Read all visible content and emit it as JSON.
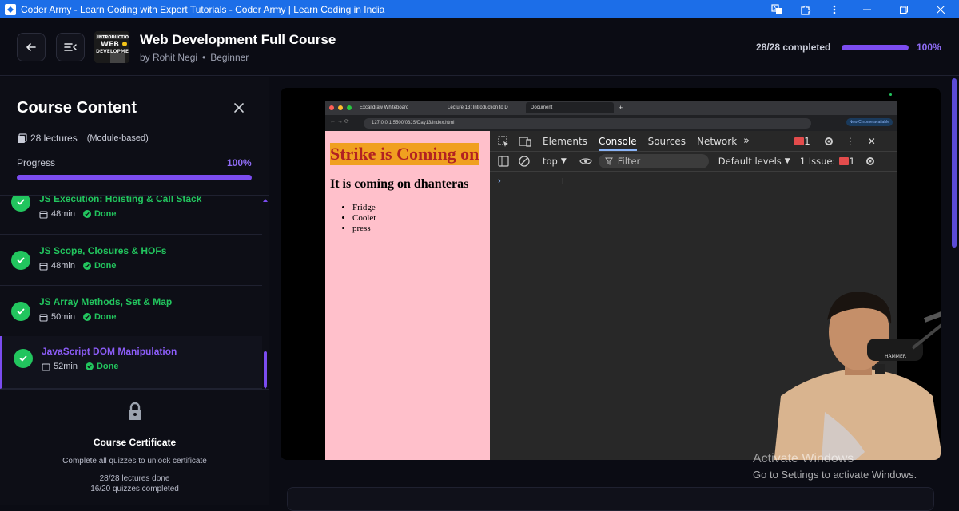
{
  "window": {
    "title": "Coder Army - Learn Coding with Expert Tutorials - Coder Army | Learn Coding in India",
    "controls": [
      "translate-icon",
      "extensions-icon",
      "menu-icon",
      "minimize-icon",
      "maximize-icon",
      "close-icon"
    ]
  },
  "header": {
    "course_title": "Web Development Full Course",
    "author": "by Rohit Negi",
    "level": "Beginner",
    "completed": "28/28 completed",
    "progress_percent": "100%",
    "progress_value": 1.0
  },
  "sidebar": {
    "title": "Course Content",
    "lectures": "28 lectures",
    "mode": "(Module-based)",
    "progress_label": "Progress",
    "progress_percent": "100%",
    "progress_value": 1.0,
    "lessons": [
      {
        "title": "JS Execution: Hoisting & Call Stack",
        "duration": "48min",
        "status": "Done"
      },
      {
        "title": "JS Scope, Closures & HOFs",
        "duration": "48min",
        "status": "Done"
      },
      {
        "title": "JS Array Methods, Set & Map",
        "duration": "50min",
        "status": "Done"
      },
      {
        "title": "JavaScript DOM Manipulation",
        "duration": "52min",
        "status": "Done"
      }
    ],
    "certificate": {
      "title": "Course Certificate",
      "description": "Complete all quizzes to unlock certificate",
      "lectures_done": "28/28 lectures done",
      "quizzes_done": "16/20 quizzes completed"
    }
  },
  "video": {
    "browser_tabs": [
      "Excalidraw Whiteboard",
      "Lecture 13: Introduction to D",
      "Document"
    ],
    "url": "127.0.0.1:5500/03JS/Day13/index.html",
    "new_chrome": "New Chrome available",
    "page": {
      "heading1": "Strike is Coming on",
      "heading2": "It is coming on dhanteras",
      "items": [
        "Fridge",
        "Cooler",
        "press"
      ]
    },
    "devtools": {
      "tabs": [
        "Elements",
        "Console",
        "Sources",
        "Network"
      ],
      "context": "top",
      "filter_placeholder": "Filter",
      "levels": "Default levels",
      "issues": "1 Issue:",
      "issue_count": "1",
      "error_count": "1"
    }
  },
  "watermark": {
    "line1": "Activate Windows",
    "line2": "Go to Settings to activate Windows."
  },
  "colors": {
    "accent": "#7b4cf0",
    "done": "#22c55e",
    "titlebar": "#1c6ee8"
  }
}
